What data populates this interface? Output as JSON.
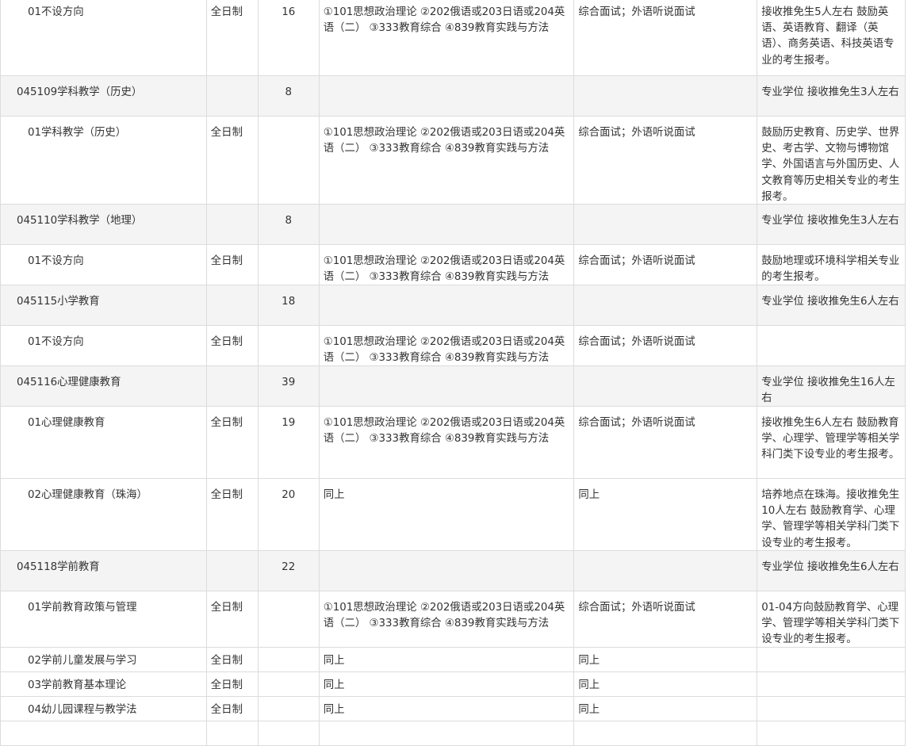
{
  "rows": [
    {
      "kind": "minor",
      "name": "01不设方向",
      "mode": "全日制",
      "quota": "16",
      "exam": "①101思想政治理论 ②202俄语或203日语或204英语（二） ③333教育综合 ④839教育实践与方法",
      "retest": "综合面试；外语听说面试",
      "note": "接收推免生5人左右 鼓励英语、英语教育、翻译（英语）、商务英语、科技英语专业的考生报考。"
    },
    {
      "kind": "major",
      "name": "045109学科教学（历史）",
      "mode": "",
      "quota": "8",
      "exam": "",
      "retest": "",
      "note": "专业学位 接收推免生3人左右"
    },
    {
      "kind": "minor",
      "name": "01学科教学（历史）",
      "mode": "全日制",
      "quota": "",
      "exam": "①101思想政治理论 ②202俄语或203日语或204英语（二） ③333教育综合 ④839教育实践与方法",
      "retest": "综合面试；外语听说面试",
      "note": "鼓励历史教育、历史学、世界史、考古学、文物与博物馆学、外国语言与外国历史、人文教育等历史相关专业的考生报考。"
    },
    {
      "kind": "major",
      "name": "045110学科教学（地理）",
      "mode": "",
      "quota": "8",
      "exam": "",
      "retest": "",
      "note": "专业学位 接收推免生3人左右"
    },
    {
      "kind": "minor",
      "name": "01不设方向",
      "mode": "全日制",
      "quota": "",
      "exam": "①101思想政治理论 ②202俄语或203日语或204英语（二） ③333教育综合 ④839教育实践与方法",
      "retest": "综合面试；外语听说面试",
      "note": "鼓励地理或环境科学相关专业的考生报考。"
    },
    {
      "kind": "major",
      "name": "045115小学教育",
      "mode": "",
      "quota": "18",
      "exam": "",
      "retest": "",
      "note": "专业学位 接收推免生6人左右"
    },
    {
      "kind": "minor",
      "name": "01不设方向",
      "mode": "全日制",
      "quota": "",
      "exam": "①101思想政治理论 ②202俄语或203日语或204英语（二） ③333教育综合 ④839教育实践与方法",
      "retest": "综合面试；外语听说面试",
      "note": ""
    },
    {
      "kind": "major",
      "name": "045116心理健康教育",
      "mode": "",
      "quota": "39",
      "exam": "",
      "retest": "",
      "note": "专业学位 接收推免生16人左右"
    },
    {
      "kind": "minor",
      "name": "01心理健康教育",
      "mode": "全日制",
      "quota": "19",
      "exam": "①101思想政治理论 ②202俄语或203日语或204英语（二） ③333教育综合 ④839教育实践与方法",
      "retest": "综合面试；外语听说面试",
      "note": "接收推免生6人左右 鼓励教育学、心理学、管理学等相关学科门类下设专业的考生报考。"
    },
    {
      "kind": "minor",
      "name": "02心理健康教育（珠海）",
      "mode": "全日制",
      "quota": "20",
      "exam": "同上",
      "retest": "同上",
      "note": "培养地点在珠海。接收推免生10人左右 鼓励教育学、心理学、管理学等相关学科门类下设专业的考生报考。"
    },
    {
      "kind": "major",
      "name": "045118学前教育",
      "mode": "",
      "quota": "22",
      "exam": "",
      "retest": "",
      "note": "专业学位 接收推免生6人左右"
    },
    {
      "kind": "minor",
      "name": "01学前教育政策与管理",
      "mode": "全日制",
      "quota": "",
      "exam": "①101思想政治理论 ②202俄语或203日语或204英语（二） ③333教育综合 ④839教育实践与方法",
      "retest": "综合面试；外语听说面试",
      "note": "01-04方向鼓励教育学、心理学、管理学等相关学科门类下设专业的考生报考。"
    },
    {
      "kind": "minor",
      "name": "02学前儿童发展与学习",
      "mode": "全日制",
      "quota": "",
      "exam": "同上",
      "retest": "同上",
      "note": ""
    },
    {
      "kind": "minor",
      "name": "03学前教育基本理论",
      "mode": "全日制",
      "quota": "",
      "exam": "同上",
      "retest": "同上",
      "note": ""
    },
    {
      "kind": "minor",
      "name": "04幼儿园课程与教学法",
      "mode": "全日制",
      "quota": "",
      "exam": "同上",
      "retest": "同上",
      "note": ""
    }
  ],
  "colors": {
    "major_row_bg": "#f4f4f4",
    "minor_row_bg": "#ffffff",
    "border": "#dcdcdc",
    "text": "#333333"
  }
}
